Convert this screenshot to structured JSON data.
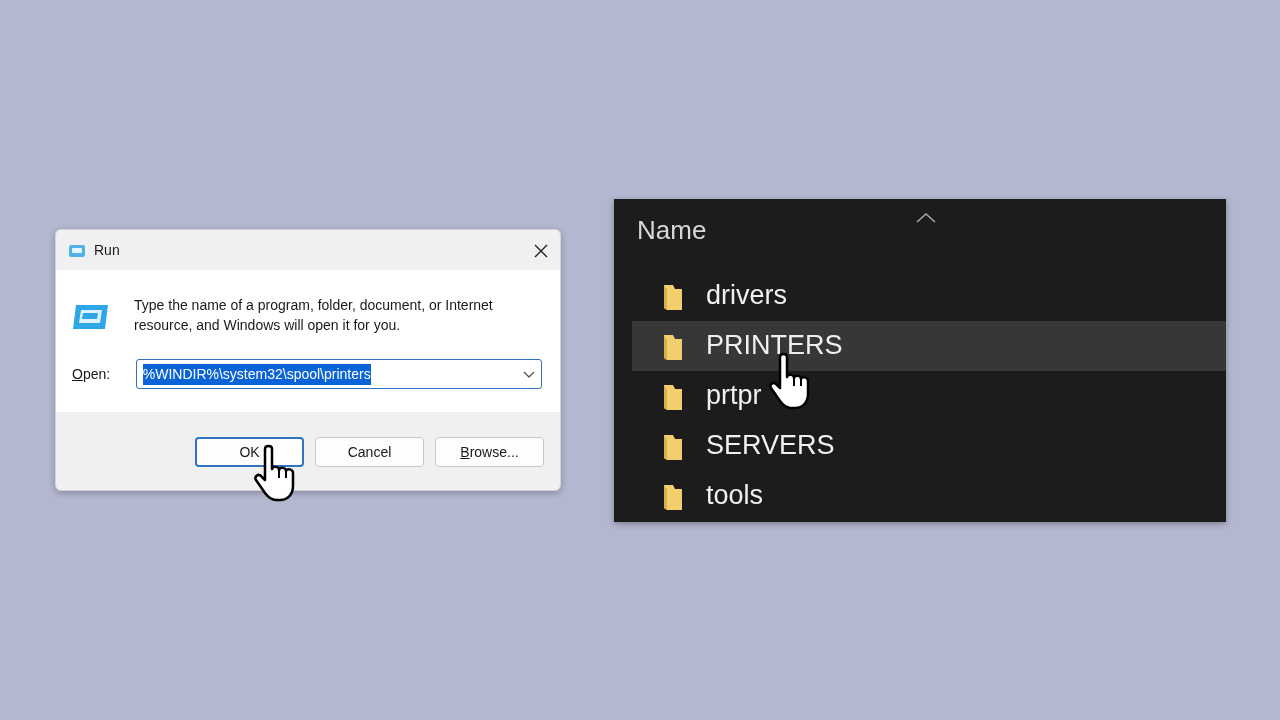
{
  "run_dialog": {
    "title": "Run",
    "description": "Type the name of a program, folder, document, or Internet resource, and Windows will open it for you.",
    "open_label": {
      "text": "Open:",
      "underline_first": true
    },
    "open_field": {
      "value": "%WINDIR%\\system32\\spool\\printers",
      "text_selected": true
    },
    "buttons": [
      {
        "label": "OK",
        "default": true,
        "underline_first": false,
        "pointer": true
      },
      {
        "label": "Cancel",
        "default": false,
        "underline_first": false,
        "pointer": false
      },
      {
        "label": "Browse...",
        "default": false,
        "underline_first": true,
        "pointer": false
      }
    ]
  },
  "explorer": {
    "column_header": "Name",
    "items": [
      {
        "name": "drivers",
        "selected": false,
        "pointer": false
      },
      {
        "name": "PRINTERS",
        "selected": true,
        "pointer": true
      },
      {
        "name": "prtpr",
        "selected": false,
        "pointer": false
      },
      {
        "name": "SERVERS",
        "selected": false,
        "pointer": false
      },
      {
        "name": "tools",
        "selected": false,
        "pointer": false
      }
    ]
  }
}
